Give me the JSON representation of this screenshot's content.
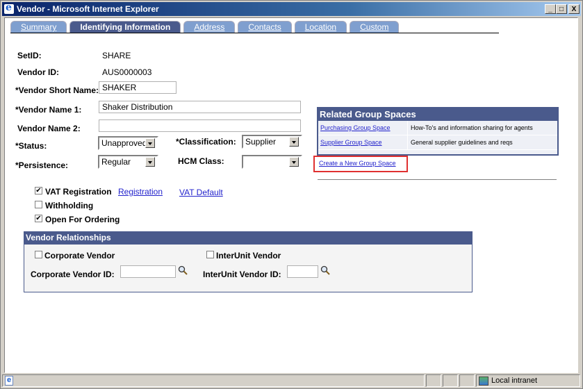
{
  "window": {
    "title": "Vendor - Microsoft Internet Explorer",
    "buttons": {
      "minimize": "_",
      "maximize": "□",
      "close": "X"
    }
  },
  "tabs": [
    {
      "label": "Summary",
      "active": false
    },
    {
      "label": "Identifying Information",
      "active": true
    },
    {
      "label": "Address",
      "active": false
    },
    {
      "label": "Contacts",
      "active": false
    },
    {
      "label": "Location",
      "active": false
    },
    {
      "label": "Custom",
      "active": false
    }
  ],
  "form": {
    "setid_label": "SetID:",
    "setid_value": "SHARE",
    "vendor_id_label": "Vendor ID:",
    "vendor_id_value": "AUS0000003",
    "short_name_label": "*Vendor Short Name:",
    "short_name_value": "SHAKER",
    "name1_label": "*Vendor Name 1:",
    "name1_value": "Shaker Distribution",
    "name2_label": "Vendor Name 2:",
    "name2_value": "",
    "status_label": "*Status:",
    "status_value": "Unapproved",
    "classification_label": "*Classification:",
    "classification_value": "Supplier",
    "persistence_label": "*Persistence:",
    "persistence_value": "Regular",
    "hcm_label": "HCM Class:",
    "hcm_value": ""
  },
  "checkboxes": {
    "vat_registration": {
      "label": "VAT Registration",
      "checked": true
    },
    "withholding": {
      "label": "Withholding",
      "checked": false
    },
    "open_for_ordering": {
      "label": "Open For Ordering",
      "checked": true
    }
  },
  "links": {
    "registration": "Registration",
    "vat_default": "VAT Default"
  },
  "related_group_spaces": {
    "title": "Related Group Spaces",
    "rows": [
      {
        "name": "Purchasing Group Space",
        "description": "How-To's and information sharing for agents"
      },
      {
        "name": "Supplier Group Space",
        "description": "General supplier guidelines and reqs"
      }
    ],
    "create_link": "Create a New Group Space"
  },
  "vendor_relationships": {
    "title": "Vendor Relationships",
    "corporate_vendor_label": "Corporate Vendor",
    "corporate_vendor_checked": false,
    "interunit_vendor_label": "InterUnit Vendor",
    "interunit_vendor_checked": false,
    "corporate_vendor_id_label": "Corporate Vendor ID:",
    "corporate_vendor_id_value": "",
    "interunit_vendor_id_label": "InterUnit Vendor ID:",
    "interunit_vendor_id_value": ""
  },
  "statusbar": {
    "zone": "Local intranet"
  }
}
